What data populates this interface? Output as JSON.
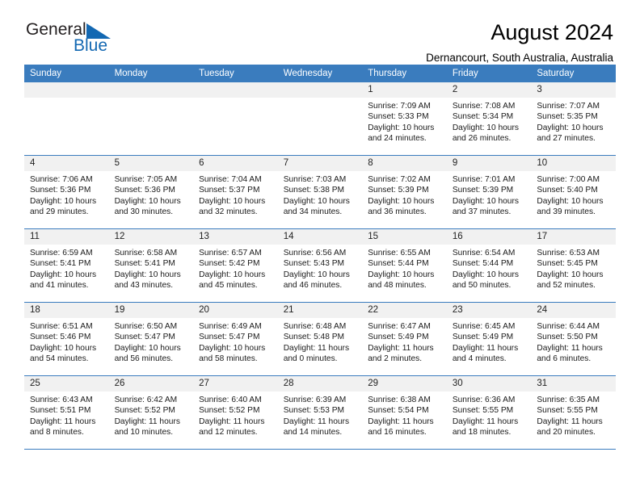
{
  "brand": {
    "name_top": "General",
    "name_bottom": "Blue",
    "triangle_icon": "triangle-icon",
    "color_dark": "#231f20",
    "color_blue": "#1368b2"
  },
  "header": {
    "title": "August 2024",
    "subtitle": "Dernancourt, South Australia, Australia",
    "accent_color": "#3a7cbe"
  },
  "calendar": {
    "weekdays": [
      "Sunday",
      "Monday",
      "Tuesday",
      "Wednesday",
      "Thursday",
      "Friday",
      "Saturday"
    ],
    "weeks": [
      [
        {
          "day": "",
          "empty": true
        },
        {
          "day": "",
          "empty": true
        },
        {
          "day": "",
          "empty": true
        },
        {
          "day": "",
          "empty": true
        },
        {
          "day": "1",
          "sunrise": "Sunrise: 7:09 AM",
          "sunset": "Sunset: 5:33 PM",
          "daylight": "Daylight: 10 hours and 24 minutes."
        },
        {
          "day": "2",
          "sunrise": "Sunrise: 7:08 AM",
          "sunset": "Sunset: 5:34 PM",
          "daylight": "Daylight: 10 hours and 26 minutes."
        },
        {
          "day": "3",
          "sunrise": "Sunrise: 7:07 AM",
          "sunset": "Sunset: 5:35 PM",
          "daylight": "Daylight: 10 hours and 27 minutes."
        }
      ],
      [
        {
          "day": "4",
          "sunrise": "Sunrise: 7:06 AM",
          "sunset": "Sunset: 5:36 PM",
          "daylight": "Daylight: 10 hours and 29 minutes."
        },
        {
          "day": "5",
          "sunrise": "Sunrise: 7:05 AM",
          "sunset": "Sunset: 5:36 PM",
          "daylight": "Daylight: 10 hours and 30 minutes."
        },
        {
          "day": "6",
          "sunrise": "Sunrise: 7:04 AM",
          "sunset": "Sunset: 5:37 PM",
          "daylight": "Daylight: 10 hours and 32 minutes."
        },
        {
          "day": "7",
          "sunrise": "Sunrise: 7:03 AM",
          "sunset": "Sunset: 5:38 PM",
          "daylight": "Daylight: 10 hours and 34 minutes."
        },
        {
          "day": "8",
          "sunrise": "Sunrise: 7:02 AM",
          "sunset": "Sunset: 5:39 PM",
          "daylight": "Daylight: 10 hours and 36 minutes."
        },
        {
          "day": "9",
          "sunrise": "Sunrise: 7:01 AM",
          "sunset": "Sunset: 5:39 PM",
          "daylight": "Daylight: 10 hours and 37 minutes."
        },
        {
          "day": "10",
          "sunrise": "Sunrise: 7:00 AM",
          "sunset": "Sunset: 5:40 PM",
          "daylight": "Daylight: 10 hours and 39 minutes."
        }
      ],
      [
        {
          "day": "11",
          "sunrise": "Sunrise: 6:59 AM",
          "sunset": "Sunset: 5:41 PM",
          "daylight": "Daylight: 10 hours and 41 minutes."
        },
        {
          "day": "12",
          "sunrise": "Sunrise: 6:58 AM",
          "sunset": "Sunset: 5:41 PM",
          "daylight": "Daylight: 10 hours and 43 minutes."
        },
        {
          "day": "13",
          "sunrise": "Sunrise: 6:57 AM",
          "sunset": "Sunset: 5:42 PM",
          "daylight": "Daylight: 10 hours and 45 minutes."
        },
        {
          "day": "14",
          "sunrise": "Sunrise: 6:56 AM",
          "sunset": "Sunset: 5:43 PM",
          "daylight": "Daylight: 10 hours and 46 minutes."
        },
        {
          "day": "15",
          "sunrise": "Sunrise: 6:55 AM",
          "sunset": "Sunset: 5:44 PM",
          "daylight": "Daylight: 10 hours and 48 minutes."
        },
        {
          "day": "16",
          "sunrise": "Sunrise: 6:54 AM",
          "sunset": "Sunset: 5:44 PM",
          "daylight": "Daylight: 10 hours and 50 minutes."
        },
        {
          "day": "17",
          "sunrise": "Sunrise: 6:53 AM",
          "sunset": "Sunset: 5:45 PM",
          "daylight": "Daylight: 10 hours and 52 minutes."
        }
      ],
      [
        {
          "day": "18",
          "sunrise": "Sunrise: 6:51 AM",
          "sunset": "Sunset: 5:46 PM",
          "daylight": "Daylight: 10 hours and 54 minutes."
        },
        {
          "day": "19",
          "sunrise": "Sunrise: 6:50 AM",
          "sunset": "Sunset: 5:47 PM",
          "daylight": "Daylight: 10 hours and 56 minutes."
        },
        {
          "day": "20",
          "sunrise": "Sunrise: 6:49 AM",
          "sunset": "Sunset: 5:47 PM",
          "daylight": "Daylight: 10 hours and 58 minutes."
        },
        {
          "day": "21",
          "sunrise": "Sunrise: 6:48 AM",
          "sunset": "Sunset: 5:48 PM",
          "daylight": "Daylight: 11 hours and 0 minutes."
        },
        {
          "day": "22",
          "sunrise": "Sunrise: 6:47 AM",
          "sunset": "Sunset: 5:49 PM",
          "daylight": "Daylight: 11 hours and 2 minutes."
        },
        {
          "day": "23",
          "sunrise": "Sunrise: 6:45 AM",
          "sunset": "Sunset: 5:49 PM",
          "daylight": "Daylight: 11 hours and 4 minutes."
        },
        {
          "day": "24",
          "sunrise": "Sunrise: 6:44 AM",
          "sunset": "Sunset: 5:50 PM",
          "daylight": "Daylight: 11 hours and 6 minutes."
        }
      ],
      [
        {
          "day": "25",
          "sunrise": "Sunrise: 6:43 AM",
          "sunset": "Sunset: 5:51 PM",
          "daylight": "Daylight: 11 hours and 8 minutes."
        },
        {
          "day": "26",
          "sunrise": "Sunrise: 6:42 AM",
          "sunset": "Sunset: 5:52 PM",
          "daylight": "Daylight: 11 hours and 10 minutes."
        },
        {
          "day": "27",
          "sunrise": "Sunrise: 6:40 AM",
          "sunset": "Sunset: 5:52 PM",
          "daylight": "Daylight: 11 hours and 12 minutes."
        },
        {
          "day": "28",
          "sunrise": "Sunrise: 6:39 AM",
          "sunset": "Sunset: 5:53 PM",
          "daylight": "Daylight: 11 hours and 14 minutes."
        },
        {
          "day": "29",
          "sunrise": "Sunrise: 6:38 AM",
          "sunset": "Sunset: 5:54 PM",
          "daylight": "Daylight: 11 hours and 16 minutes."
        },
        {
          "day": "30",
          "sunrise": "Sunrise: 6:36 AM",
          "sunset": "Sunset: 5:55 PM",
          "daylight": "Daylight: 11 hours and 18 minutes."
        },
        {
          "day": "31",
          "sunrise": "Sunrise: 6:35 AM",
          "sunset": "Sunset: 5:55 PM",
          "daylight": "Daylight: 11 hours and 20 minutes."
        }
      ]
    ]
  }
}
